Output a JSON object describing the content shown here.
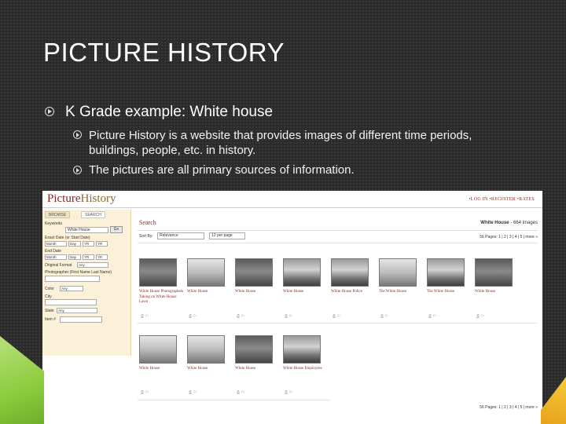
{
  "slide": {
    "title": "PICTURE HISTORY",
    "bullets": [
      "K Grade example: White house",
      "Picture History is a website that provides images of different time periods, buildings, people, etc. in history.",
      "The pictures are all primary sources of information."
    ]
  },
  "screenshot": {
    "logo_picture": "Picture",
    "logo_history": "History",
    "top_links": "•LOG IN •REGISTER •RATES",
    "tabs": [
      "BROWSE",
      "SEARCH"
    ],
    "sidebar": {
      "keywords_label": "Keywords",
      "keywords_value": "White House",
      "go_button": "Go",
      "exact_date_label": "Exact Date (or Start Date)",
      "end_date_label": "End Date",
      "month": "Month",
      "day": "Day",
      "yr": "YR",
      "original_format_label": "Original Format",
      "original_format_value": "Any",
      "photographer_label": "Photographer (First Name Last Name)",
      "color_label": "Color",
      "color_value": "Any",
      "city_label": "City",
      "state_label": "State",
      "state_value": "Any",
      "item_label": "Item #"
    },
    "search_title": "Search",
    "results_label_bold": "White House",
    "results_label_count": "- 664 images",
    "sort_label": "Sort By:",
    "sort_value": "Relevance",
    "per_page_value": "12 per page",
    "pages_top": "56 Pages: 1 | 2 | 3 | 4 | 5 | more »",
    "pages_bottom": "56 Pages: 1 | 2 | 3 | 4 | 5 | more »",
    "results": [
      {
        "caption": "White House Photographers Taking on White House Lawn"
      },
      {
        "caption": "White House"
      },
      {
        "caption": "White House"
      },
      {
        "caption": "White House"
      },
      {
        "caption": "White House Police"
      },
      {
        "caption": "The White House"
      },
      {
        "caption": "The White House"
      },
      {
        "caption": "White House"
      },
      {
        "caption": "White House"
      },
      {
        "caption": "White House"
      },
      {
        "caption": "White House"
      },
      {
        "caption": "White House Employees"
      }
    ]
  },
  "colors": {
    "background": "#2b2b2b",
    "accent_red": "#8a2b22",
    "sidebar_bg": "#fbf1d8",
    "green_accent": "#8ccc3d",
    "gold_accent": "#e8a21c"
  }
}
